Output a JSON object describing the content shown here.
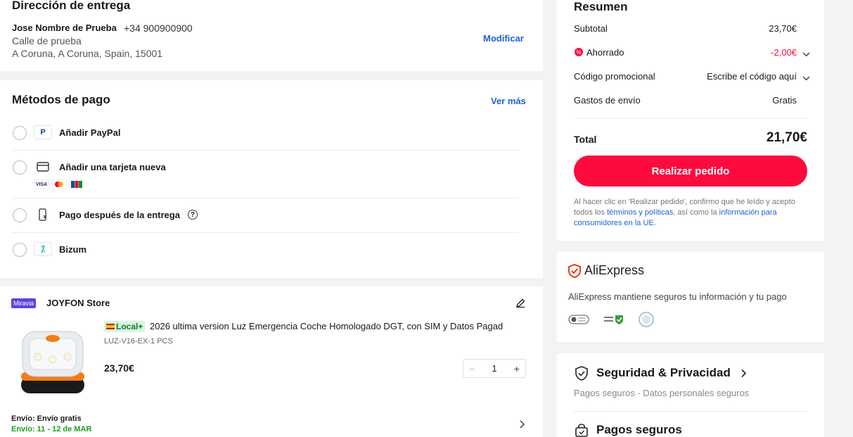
{
  "address": {
    "title": "Dirección de entrega",
    "name": "Jose Nombre de Prueba",
    "phone": "+34 900900900",
    "street": "Calle de prueba",
    "city_line": "A Coruna, A Coruna, Spain, 15001",
    "modify_label": "Modificar"
  },
  "payment": {
    "title": "Métodos de pago",
    "see_more_label": "Ver más",
    "methods": [
      {
        "label": "Añadir PayPal",
        "icon": "paypal-icon"
      },
      {
        "label": "Añadir una tarjeta nueva",
        "icon": "credit-card-icon",
        "brands": [
          "VISA",
          "MC",
          "JCB"
        ]
      },
      {
        "label": "Pago después de la entrega",
        "icon": "pay-on-delivery-icon"
      },
      {
        "label": "Bizum",
        "icon": "bizum-icon"
      }
    ]
  },
  "store": {
    "badge": "Miravia",
    "name": "JOYFON Store",
    "product": {
      "local_badge": "Local+",
      "title": "2026 ultima version Luz Emergencia Coche Homologado DGT, con SIM y Datos Pagad",
      "variant": "LUZ-V16-EX-1 PCS",
      "price": "23,70€",
      "quantity": "1",
      "minus": "−",
      "plus": "+"
    },
    "shipping_label": "Envío: Envío gratis",
    "delivery_label": "Envío: 11 - 12 de MAR"
  },
  "summary": {
    "title": "Resumen",
    "subtotal_label": "Subtotal",
    "subtotal_value": "23,70€",
    "saved_label": "Ahorrado",
    "saved_value": "-2,00€",
    "promo_label": "Código promocional",
    "promo_value": "Escribe el código aquí",
    "shipping_label": "Gastos de envío",
    "shipping_value": "Gratis",
    "total_label": "Total",
    "total_value": "21,70€",
    "place_order_label": "Realizar pedido",
    "legal_prefix": "Al hacer clic en 'Realizar pedido', confirmo que he leído y acepto todos los ",
    "legal_link1": "términos y políticas",
    "legal_middle": ", así como la ",
    "legal_link2": "información para consumidores en la UE",
    "legal_suffix": "."
  },
  "trust": {
    "brand": "AliExpress",
    "text": "AliExpress mantiene seguros tu información y tu pago"
  },
  "security": {
    "title": "Seguridad & Privacidad",
    "subtitle": "Pagos seguros · Datos personales seguros",
    "payments_title": "Pagos seguros"
  },
  "colors": {
    "accent": "#fd0a3e",
    "link": "#1d61d6",
    "success": "#1ba11b"
  }
}
